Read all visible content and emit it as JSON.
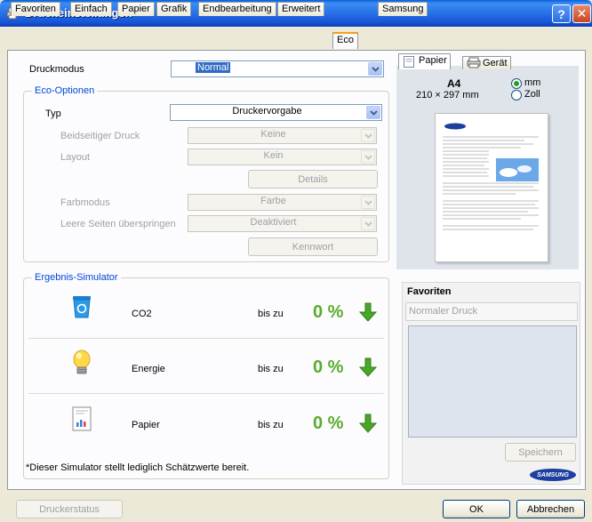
{
  "window": {
    "title": "Druckeinstellungen",
    "help_label": "?",
    "close_label": "✕"
  },
  "tabs": [
    "Favoriten",
    "Einfach",
    "Papier",
    "Grafik",
    "Endbearbeitung",
    "Erweitert",
    "Eco",
    "Samsung"
  ],
  "active_tab": "Eco",
  "print_mode": {
    "label": "Druckmodus",
    "value": "Normal"
  },
  "eco_options": {
    "title": "Eco-Optionen",
    "type_label": "Typ",
    "type_value": "Druckervorgabe",
    "duplex_label": "Beidseitiger Druck",
    "duplex_value": "Keine",
    "layout_label": "Layout",
    "layout_value": "Kein",
    "details_button": "Details",
    "color_mode_label": "Farbmodus",
    "color_mode_value": "Farbe",
    "skip_blank_label": "Leere Seiten überspringen",
    "skip_blank_value": "Deaktiviert",
    "password_button": "Kennwort"
  },
  "simulator": {
    "title": "Ergebnis-Simulator",
    "rows": [
      {
        "name": "CO2",
        "prefix": "bis zu",
        "value": "0 %",
        "icon": "recycle-bin-icon"
      },
      {
        "name": "Energie",
        "prefix": "bis zu",
        "value": "0 %",
        "icon": "light-bulb-icon"
      },
      {
        "name": "Papier",
        "prefix": "bis zu",
        "value": "0 %",
        "icon": "paper-document-icon"
      }
    ],
    "footnote": "*Dieser Simulator stellt lediglich Schätzwerte bereit."
  },
  "preview": {
    "tab_paper": "Papier",
    "tab_device": "Gerät",
    "paper_size": "A4",
    "paper_dims": "210 × 297 mm",
    "unit_mm": "mm",
    "unit_inch": "Zoll",
    "unit_selected": "mm"
  },
  "favorites": {
    "title": "Favoriten",
    "input_placeholder": "Normaler Druck",
    "save_button": "Speichern",
    "brand": "SAMSUNG"
  },
  "bottom": {
    "status_button": "Druckerstatus",
    "ok_button": "OK",
    "cancel_button": "Abbrechen"
  },
  "colors": {
    "accent_blue": "#0046d5",
    "eco_green": "#5bab2e",
    "selection": "#316ac5"
  }
}
